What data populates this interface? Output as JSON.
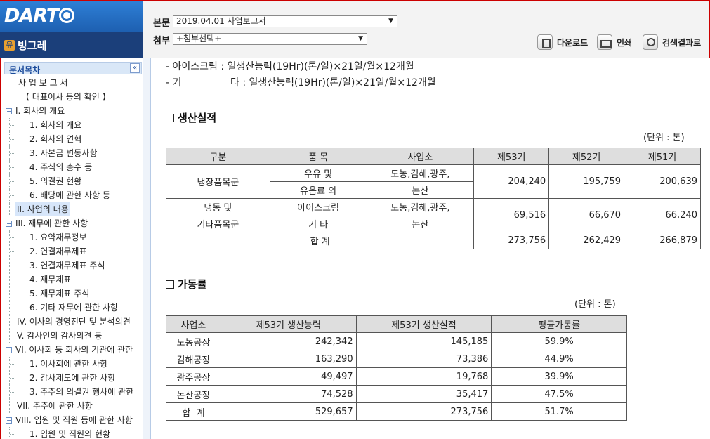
{
  "header": {
    "logo": "DART",
    "company_badge": "유",
    "company_name": "빙그레",
    "main_doc_label": "본문",
    "main_doc_value": "2019.04.01   사업보고서",
    "attach_label": "첨부",
    "attach_value": "+첨부선택+",
    "download_label": "다운로드",
    "print_label": "인쇄",
    "search_results_label": "검색결과로"
  },
  "sidebar": {
    "title": "문서목차",
    "collapse_icon": "«",
    "items": [
      {
        "label": "사 업 보 고 서"
      },
      {
        "label": "【 대표이사 등의 확인 】"
      },
      {
        "label": "I. 회사의 개요"
      },
      {
        "label": "1. 회사의 개요"
      },
      {
        "label": "2. 회사의 연혁"
      },
      {
        "label": "3. 자본금 변동사항"
      },
      {
        "label": "4. 주식의 총수 등"
      },
      {
        "label": "5. 의결권 현황"
      },
      {
        "label": "6. 배당에 관한 사항 등"
      },
      {
        "label": "II. 사업의 내용"
      },
      {
        "label": "III. 재무에 관한 사항"
      },
      {
        "label": "1. 요약재무정보"
      },
      {
        "label": "2. 연결재무제표"
      },
      {
        "label": "3. 연결재무제표 주석"
      },
      {
        "label": "4. 재무제표"
      },
      {
        "label": "5. 재무제표 주석"
      },
      {
        "label": "6. 기타 재무에 관한 사항"
      },
      {
        "label": "IV. 이사의 경영진단 및 분석의견"
      },
      {
        "label": "V. 감사인의 감사의견 등"
      },
      {
        "label": "VI. 이사회 등 회사의 기관에 관한"
      },
      {
        "label": "1. 이사회에 관한 사항"
      },
      {
        "label": "2. 감사제도에 관한 사항"
      },
      {
        "label": "3. 주주의 의결권 행사에 관한"
      },
      {
        "label": "VII. 주주에 관한 사항"
      },
      {
        "label": "VIII. 임원 및 직원 등에 관한 사항"
      },
      {
        "label": "1. 임원 및 직원의 현황"
      }
    ]
  },
  "content": {
    "line1": "- 아이스크림 : 일생산능력(19Hr)(톤/일)×21일/월×12개월",
    "line2_prefix": "- 기",
    "line2_rest": "타 : 일생산능력(19Hr)(톤/일)×21일/월×12개월",
    "production": {
      "title": "생산실적",
      "unit": "(단위 : 톤)",
      "headers": [
        "구분",
        "품 목",
        "사업소",
        "제53기",
        "제52기",
        "제51기"
      ],
      "rows": [
        {
          "category": "냉장품목군",
          "item_1": "우유 및",
          "item_2": "유음료 외",
          "site_1": "도농,김해,광주,",
          "site_2": "논산",
          "v53": "204,240",
          "v52": "195,759",
          "v51": "200,639"
        },
        {
          "category_1": "냉동 및",
          "category_2": "기타품목군",
          "item_1": "아이스크림",
          "item_2": "기 타",
          "site_1": "도농,김해,광주,",
          "site_2": "논산",
          "v53": "69,516",
          "v52": "66,670",
          "v51": "66,240"
        }
      ],
      "total": {
        "label": "합 계",
        "v53": "273,756",
        "v52": "262,429",
        "v51": "266,879"
      }
    },
    "utilization": {
      "title": "가동률",
      "unit": "(단위 : 톤)",
      "headers": [
        "사업소",
        "제53기 생산능력",
        "제53기 생산실적",
        "평균가동률"
      ],
      "rows": [
        {
          "site": "도농공장",
          "capacity": "242,342",
          "actual": "145,185",
          "rate": "59.9%"
        },
        {
          "site": "김해공장",
          "capacity": "163,290",
          "actual": "73,386",
          "rate": "44.9%"
        },
        {
          "site": "광주공장",
          "capacity": "49,497",
          "actual": "19,768",
          "rate": "39.9%"
        },
        {
          "site": "논산공장",
          "capacity": "74,528",
          "actual": "35,417",
          "rate": "47.5%"
        },
        {
          "site": "합  계",
          "capacity": "529,657",
          "actual": "273,756",
          "rate": "51.7%"
        }
      ]
    }
  }
}
